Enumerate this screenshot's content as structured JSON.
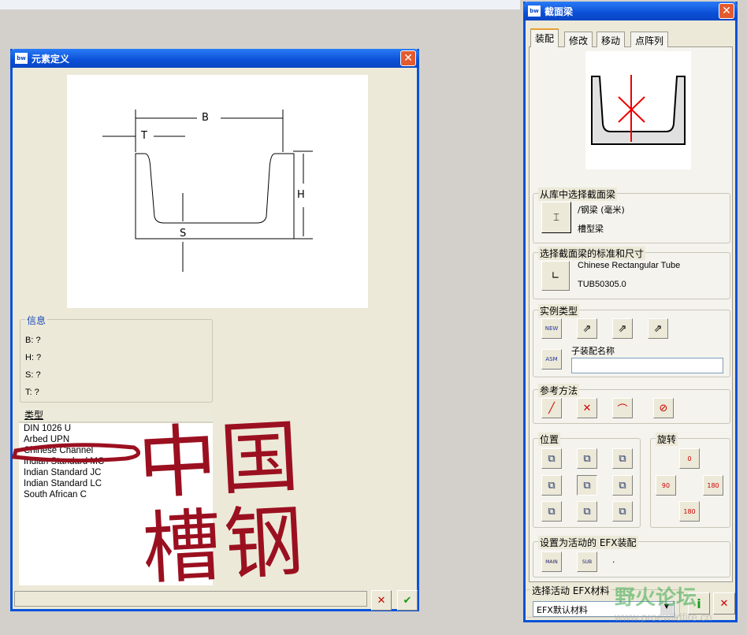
{
  "left_dialog": {
    "title": "元素定义",
    "drawing_labels": {
      "B": "B",
      "T": "T",
      "H": "H",
      "S": "S"
    },
    "info": {
      "legend": "信息",
      "rows": [
        "B: ?",
        "H: ?",
        "S: ?",
        "T: ?"
      ]
    },
    "list": {
      "header": "类型",
      "items": [
        "DIN 1026 U",
        "Arbed UPN",
        "Chinese Channel",
        "Indian Standard MC",
        "Indian Standard JC",
        "Indian Standard LC",
        "South African C"
      ],
      "selected": "Chinese Channel"
    },
    "annotation": "中国槽钢"
  },
  "right_dialog": {
    "title": "截面梁",
    "tabs": [
      "装配",
      "修改",
      "移动",
      "点阵列"
    ],
    "active_tab": "装配",
    "library": {
      "legend": "从库中选择截面梁",
      "line1": "/钢梁 (毫米)",
      "line2": "槽型梁"
    },
    "standard": {
      "legend": "选择截面梁的标准和尺寸",
      "line1": "Chinese Rectangular Tube",
      "line2": "TUB50305.0"
    },
    "instance": {
      "legend": "实例类型",
      "subasm_label": "子装配名称",
      "subasm_value": ""
    },
    "reference": {
      "legend": "参考方法"
    },
    "position": {
      "legend": "位置"
    },
    "rotation": {
      "legend": "旋转",
      "labels": [
        "0",
        "90",
        "180",
        "180"
      ]
    },
    "active_asm": {
      "legend": "设置为活动的 EFX装配",
      "value": "."
    },
    "material": {
      "legend": "选择活动 EFX材料",
      "selected": "EFX默认材料"
    }
  },
  "watermark": {
    "text": "野火论坛",
    "url": "www.proewildfire.cn"
  },
  "colors": {
    "title_bar": "#0a4fd6",
    "annotation": "#9b1020"
  }
}
